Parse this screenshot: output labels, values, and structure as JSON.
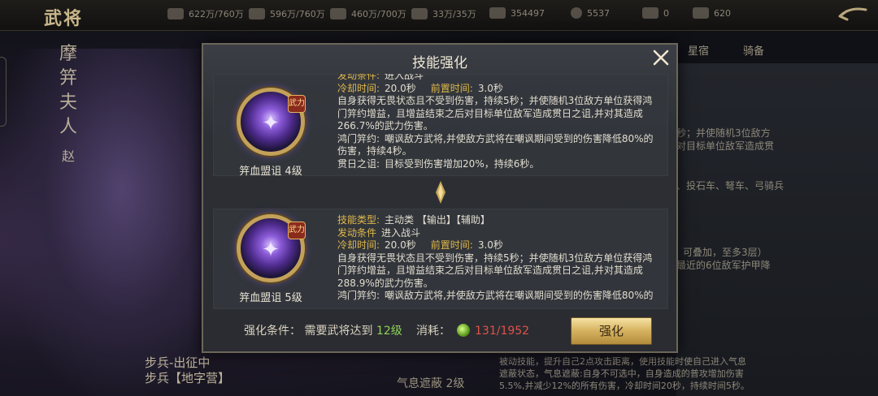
{
  "header": {
    "page_title": "武将",
    "resources": [
      {
        "icon": "wood-icon",
        "value": "622万/760万"
      },
      {
        "icon": "stone-icon",
        "value": "596万/760万"
      },
      {
        "icon": "iron-icon",
        "value": "460万/700万"
      },
      {
        "icon": "grain-icon",
        "value": "33万/35万"
      },
      {
        "icon": "banner-icon",
        "value": "354497"
      },
      {
        "icon": "copper-coin-icon",
        "value": "5537"
      },
      {
        "icon": "gold-ingot-icon",
        "value": "0"
      },
      {
        "icon": "silver-ingot-icon",
        "value": "620"
      }
    ]
  },
  "general": {
    "name_chars": [
      "摩",
      "笄",
      "夫",
      "人"
    ],
    "faction": "赵"
  },
  "behind_tabs": [
    "星宿",
    "骑备"
  ],
  "behind_right_text": [
    "秒；并使随机3位敌方",
    "对目标单位敌军造成贯",
    "、投石车、弩车、弓骑兵",
    "可叠加，至多3层）",
    "最近的6位敌军护甲降",
    "被动技能，提升自己2点攻击距离，使用技能时使自己进入气息",
    "遮蔽状态，气息遮蔽:自身不可选中，自身造成的普攻增加伤害",
    "5.5%,并减少12%的所有伤害，冷却时间20秒，持续时间5秒。"
  ],
  "behind_bottom": {
    "line1": "步兵-出征中",
    "line2": "步兵【地字营】",
    "skill_label": "气息遮蔽 2级"
  },
  "dialog": {
    "title": "技能强化",
    "skills": [
      {
        "name": "笄血盟诅 4级",
        "badge": "武力",
        "trigger_label": "发动条件:",
        "trigger_value": "进入战斗",
        "cooldown_label": "冷却时间:",
        "cooldown_value": "20.0秒",
        "precast_label": "前置时间:",
        "precast_value": "3.0秒",
        "desc_lines": [
          "自身获得无畏状态且不受到伤害，持续5秒；并使随机3位敌方单位获得鸿",
          "门笄约增益，且增益结束之后对目标单位敌军造成贯日之诅,并对其造成",
          "266.7%的武力伤害。"
        ],
        "extra": [
          {
            "label": "鸿门笄约:",
            "lines": [
              "嘲讽敌方武将,并使敌方武将在嘲讽期间受到的伤害降低80%的",
              "伤害，持续4秒。"
            ]
          },
          {
            "label": "贯日之诅:",
            "lines": [
              "目标受到伤害增加20%，持续6秒。"
            ]
          }
        ]
      },
      {
        "name": "笄血盟诅 5级",
        "badge": "武力",
        "type_label": "技能类型:",
        "type_value": "主动类 【输出】【辅助】",
        "trigger_label": "发动条件",
        "trigger_value": "进入战斗",
        "cooldown_label": "冷却时间:",
        "cooldown_value": "20.0秒",
        "precast_label": "前置时间:",
        "precast_value": "3.0秒",
        "desc_lines": [
          "自身获得无畏状态且不受到伤害，持续5秒；并使随机3位敌方单位获得鸿",
          "门笄约增益，且增益结束之后对目标单位敌军造成贯日之诅,并对其造成",
          "288.9%的武力伤害。"
        ],
        "extra": [
          {
            "label": "鸿门笄约:",
            "lines": [
              "嘲讽敌方武将,并使敌方武将在嘲讽期间受到的伤害降低80%的"
            ]
          }
        ]
      }
    ],
    "footer": {
      "condition_label": "强化条件：",
      "condition_text": "需要武将达到",
      "condition_level": "12级",
      "cost_label": "消耗：",
      "cost_amount": "131/1952",
      "upgrade_label": "强化"
    }
  }
}
